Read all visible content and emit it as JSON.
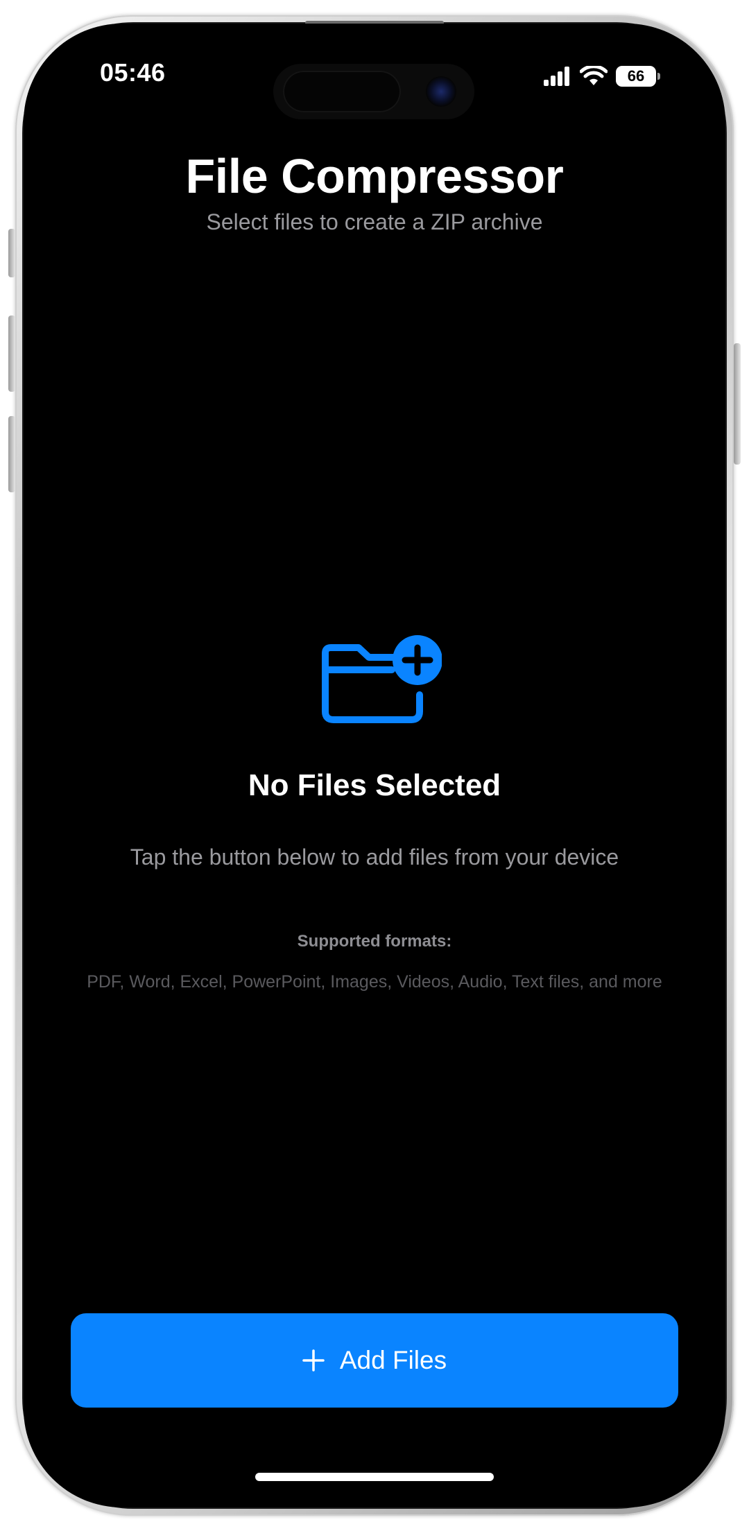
{
  "status_bar": {
    "time": "05:46",
    "battery_level": "66",
    "icons": [
      "cellular-signal-icon",
      "wifi-icon",
      "battery-icon"
    ]
  },
  "header": {
    "title": "File Compressor",
    "subtitle": "Select files to create a ZIP archive"
  },
  "empty_state": {
    "icon": "folder-plus-icon",
    "title": "No Files Selected",
    "description": "Tap the button below to add files from your device",
    "formats_label": "Supported formats:",
    "formats_list": "PDF, Word, Excel, PowerPoint, Images, Videos, Audio, Text files, and more"
  },
  "actions": {
    "add_files_label": "Add Files",
    "add_files_icon": "plus-icon"
  },
  "colors": {
    "accent": "#0a84ff",
    "background": "#000000",
    "text_primary": "#ffffff",
    "text_secondary": "#9a9a9e",
    "text_tertiary": "#5a5a5e"
  }
}
